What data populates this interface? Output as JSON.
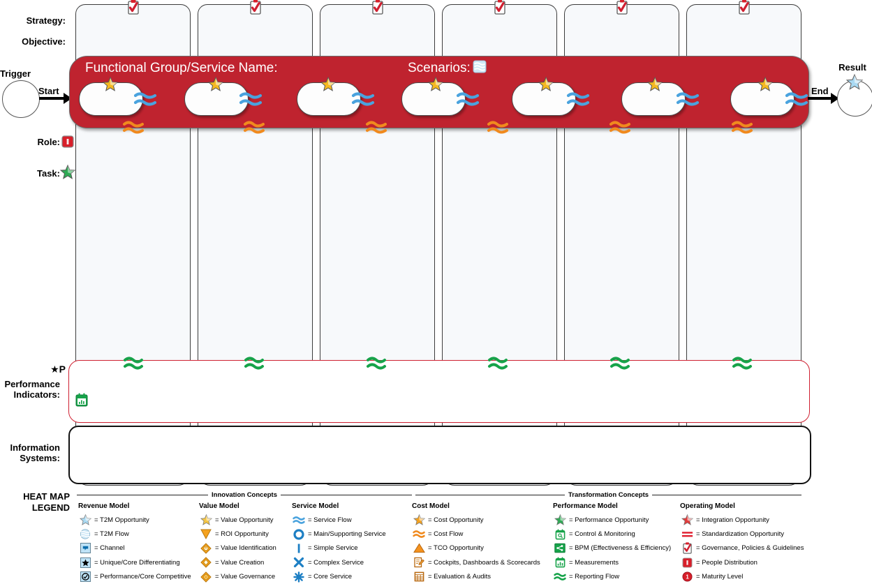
{
  "left_labels": {
    "strategy": "Strategy:",
    "objective": "Objective:",
    "trigger": "Trigger",
    "start": "Start",
    "role": "Role:",
    "task": "Task:",
    "star_p": "★P",
    "performance_indicators_1": "Performance",
    "performance_indicators_2": "Indicators:",
    "information_systems_1": "Information",
    "information_systems_2": "Systems:",
    "heat_map_1": "HEAT MAP",
    "heat_map_2": "LEGEND"
  },
  "right_labels": {
    "end": "End",
    "result": "Result"
  },
  "band": {
    "functional_group": "Functional Group/Service Name:",
    "scenarios": "Scenarios:",
    "scenarios_icon": "t2m-flow-icon",
    "service_star_icon": "value-opportunity-star-icon",
    "service_flow_icon": "service-flow-icon",
    "cost_flow_icon": "cost-flow-icon",
    "reporting_flow_icon": "reporting-flow-icon",
    "governance_icon": "governance-clipboard-icon",
    "role_icon": "people-distribution-icon",
    "task_icon": "performance-opportunity-star-icon",
    "pi_icon": "measurements-icon",
    "result_icon": "t2m-opportunity-star-icon",
    "column_count": 6
  },
  "colors": {
    "band_red": "#bf232f",
    "pi_border_red": "#cf2031",
    "column_fill": "#f7f9fb",
    "blue": "#4aa3de",
    "orange": "#f08a1e",
    "green": "#17a34a",
    "yellow": "#f6c437"
  },
  "legend": {
    "group_titles": [
      "Innovation Concepts",
      "Transformation Concepts"
    ],
    "columns": [
      {
        "title": "Revenue Model",
        "items": [
          {
            "icon": "t2m-opportunity-star-icon",
            "label": "= T2M Opportunity"
          },
          {
            "icon": "t2m-flow-icon",
            "label": "= T2M Flow"
          },
          {
            "icon": "channel-icon",
            "label": "= Channel"
          },
          {
            "icon": "unique-core-differentiating-icon",
            "label": "= Unique/Core Differentiating"
          },
          {
            "icon": "performance-core-competitive-icon",
            "label": "= Performance/Core Competitive"
          }
        ]
      },
      {
        "title": "Value Model",
        "items": [
          {
            "icon": "value-opportunity-star-icon",
            "label": "= Value Opportunity"
          },
          {
            "icon": "roi-opportunity-icon",
            "label": "= ROI Opportunity"
          },
          {
            "icon": "value-identification-icon",
            "label": "= Value Identification"
          },
          {
            "icon": "value-creation-icon",
            "label": "= Value Creation"
          },
          {
            "icon": "value-governance-icon",
            "label": "= Value Governance"
          }
        ]
      },
      {
        "title": "Service Model",
        "items": [
          {
            "icon": "service-flow-icon",
            "label": "= Service Flow"
          },
          {
            "icon": "main-supporting-service-icon",
            "label": "= Main/Supporting Service"
          },
          {
            "icon": "simple-service-icon",
            "label": "= Simple Service"
          },
          {
            "icon": "complex-service-icon",
            "label": "= Complex Service"
          },
          {
            "icon": "core-service-icon",
            "label": "= Core Service"
          }
        ]
      },
      {
        "title": "Cost Model",
        "items": [
          {
            "icon": "cost-opportunity-star-icon",
            "label": "= Cost Opportunity"
          },
          {
            "icon": "cost-flow-icon",
            "label": "= Cost Flow"
          },
          {
            "icon": "tco-opportunity-icon",
            "label": "= TCO Opportunity"
          },
          {
            "icon": "cockpits-dashboards-scorecards-icon",
            "label": "= Cockpits, Dashboards & Scorecards"
          },
          {
            "icon": "evaluation-audits-icon",
            "label": "= Evaluation & Audits"
          }
        ]
      },
      {
        "title": "Performance Model",
        "items": [
          {
            "icon": "performance-opportunity-star-icon",
            "label": "= Performance Opportunity"
          },
          {
            "icon": "control-monitoring-icon",
            "label": "= Control & Monitoring"
          },
          {
            "icon": "bpm-icon",
            "label": "= BPM (Effectiveness & Efficiency)"
          },
          {
            "icon": "measurements-icon",
            "label": "= Measurements"
          },
          {
            "icon": "reporting-flow-icon",
            "label": "= Reporting Flow"
          }
        ]
      },
      {
        "title": "Operating Model",
        "items": [
          {
            "icon": "integration-opportunity-star-icon",
            "label": "= Integration Opportunity"
          },
          {
            "icon": "standardization-opportunity-icon",
            "label": "= Standardization Opportunity"
          },
          {
            "icon": "governance-clipboard-icon",
            "label": "= Governance, Policies & Guidelines"
          },
          {
            "icon": "people-distribution-icon",
            "label": "= People Distribution"
          },
          {
            "icon": "maturity-level-icon",
            "label": "= Maturity Level"
          }
        ]
      }
    ]
  }
}
